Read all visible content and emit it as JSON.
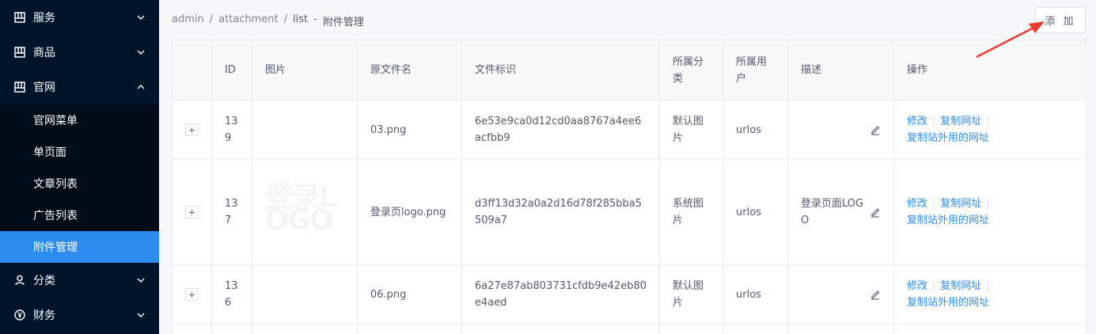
{
  "sidebar": {
    "items": [
      {
        "label": "服务",
        "icon": "grid-icon",
        "expanded": false
      },
      {
        "label": "商品",
        "icon": "grid-icon",
        "expanded": false
      },
      {
        "label": "官网",
        "icon": "grid-icon",
        "expanded": true
      }
    ],
    "subitems": [
      {
        "label": "官网菜单"
      },
      {
        "label": "单页面"
      },
      {
        "label": "文章列表"
      },
      {
        "label": "广告列表"
      },
      {
        "label": "附件管理",
        "active": true
      }
    ],
    "bottom_items": [
      {
        "label": "分类",
        "icon": "user-icon"
      },
      {
        "label": "财务",
        "icon": "yen-icon"
      }
    ]
  },
  "breadcrumb": {
    "parts": [
      "admin",
      "/",
      "attachment",
      "/",
      "list",
      "-",
      "附件管理"
    ]
  },
  "toolbar": {
    "add_label": "添 加"
  },
  "table": {
    "headers": [
      "",
      "ID",
      "图片",
      "原文件名",
      "文件标识",
      "所属分类",
      "所属用户",
      "描述",
      "操作"
    ],
    "rows": [
      {
        "id": "139",
        "image": "",
        "filename": "03.png",
        "hash": "6e53e9ca0d12cd0aa8767a4ee6acfbb9",
        "category": "默认图片",
        "user": "urlos",
        "desc": ""
      },
      {
        "id": "137",
        "image": "登录LOGO",
        "filename": "登录页logo.png",
        "hash": "d3ff13d32a0a2d16d78f285bba5509a7",
        "category": "系统图片",
        "user": "urlos",
        "desc": "登录页面LOGO"
      },
      {
        "id": "136",
        "image": "",
        "filename": "06.png",
        "hash": "6a27e87ab803731cfdb9e42eb80e4aed",
        "category": "默认图片",
        "user": "urlos",
        "desc": ""
      }
    ],
    "actions": {
      "edit": "修改",
      "copy_url": "复制网址",
      "copy_external": "复制站外用的网址"
    },
    "expand_symbol": "+"
  },
  "colors": {
    "sidebar_bg": "#001529",
    "active": "#2d8cf0",
    "link": "#2d8cf0",
    "arrow": "#e8392f"
  }
}
